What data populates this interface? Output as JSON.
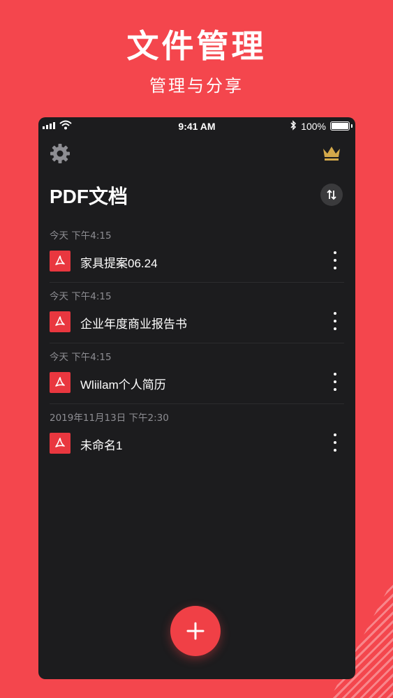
{
  "promo": {
    "title": "文件管理",
    "subtitle": "管理与分享"
  },
  "statusbar": {
    "time": "9:41 AM",
    "battery": "100%"
  },
  "header": {
    "title": "PDF文档",
    "settings_icon": "gear-icon",
    "premium_icon": "crown-icon",
    "sort_icon": "sort-icon"
  },
  "files": [
    {
      "date": "今天  下午4:15",
      "name": "家具提案06.24"
    },
    {
      "date": "今天  下午4:15",
      "name": "企业年度商业报告书"
    },
    {
      "date": "今天  下午4:15",
      "name": "Wliilam个人简历"
    },
    {
      "date": "2019年11月13日  下午2:30",
      "name": "未命名1"
    }
  ],
  "colors": {
    "background": "#f4464d",
    "phone_bg": "#1c1c1e",
    "accent": "#e9373f",
    "crown": "#d4a94a"
  }
}
